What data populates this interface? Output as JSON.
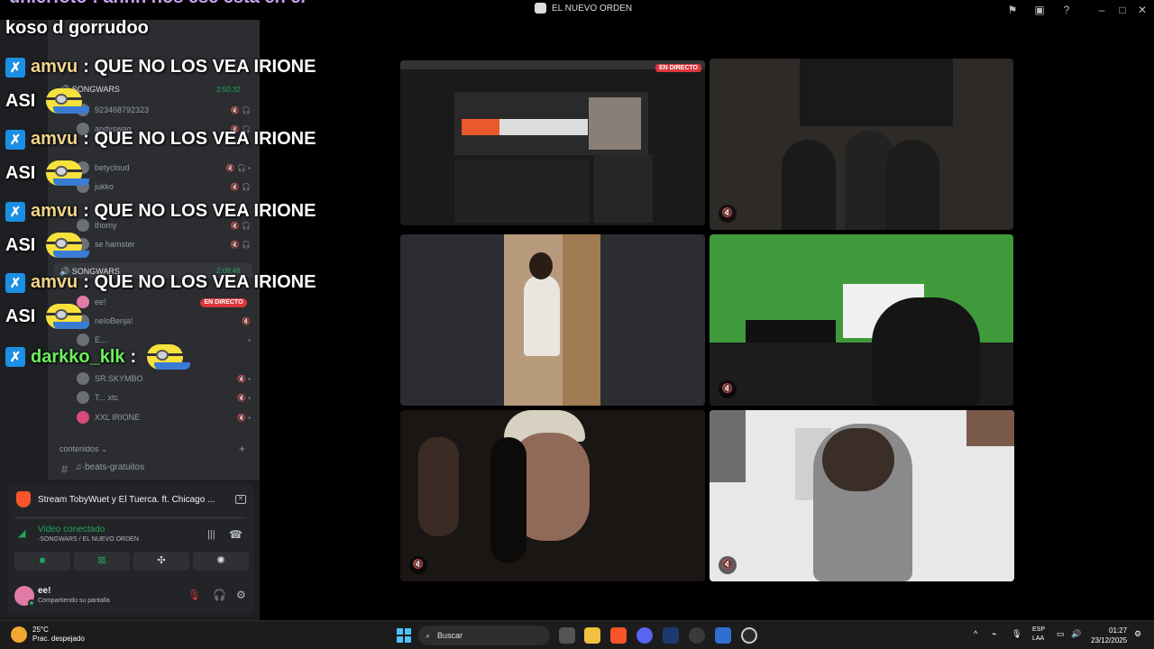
{
  "window": {
    "title": "EL NUEVO ORDEN"
  },
  "chat": {
    "top_partial_line": "unierfoto : ahhh nos ese esta en el",
    "top_line_2": "koso d gorrudoo",
    "messages": [
      {
        "user": "amvu",
        "text": ": QUE NO LOS VEA IRIONE",
        "cont": "ASI"
      },
      {
        "user": "amvu",
        "text": ": QUE NO LOS VEA IRIONE",
        "cont": "ASI"
      },
      {
        "user": "amvu",
        "text": ": QUE NO LOS VEA IRIONE",
        "cont": "ASI"
      },
      {
        "user": "amvu",
        "text": ": QUE NO LOS VEA IRIONE",
        "cont": "ASI"
      }
    ],
    "last_user": "darkko_klk",
    "last_sep": ":"
  },
  "sidebar": {
    "voice_channel_1": "SONGWARS",
    "voice_channel_1_timer": "2:50:32",
    "members_1": [
      "923468792323",
      "andyswag",
      "betycloud",
      "jukko",
      "thomy",
      "se hamster"
    ],
    "voice_channel_2": "SONGWARS",
    "voice_channel_2_timer": "2:08:46",
    "live_badge": "EN DIRECTO",
    "members_2": [
      "ee!",
      "neloBenja!",
      "E...",
      "SR.SKYMBO",
      "T... xtc",
      "XXL IRIONE"
    ],
    "section": "contenidos",
    "text_channel": "♫·beats-gratuitos"
  },
  "panel": {
    "stream_title": "Stream TobyWuet y El Tuerca. ft. Chicago ...",
    "voice_status": "Video conectado",
    "voice_location": "·SONGWARS / EL NUEVO ORDEN",
    "username": "ee!",
    "user_status": "Compartiendo su pantalla"
  },
  "tiles": {
    "live_label": "EN DIRECTO"
  },
  "taskbar": {
    "temperature": "25°C",
    "weather": "Prac. despejado",
    "search_placeholder": "Buscar",
    "lang_1": "ESP",
    "lang_2": "LAA",
    "time": "01:27",
    "date": "23/12/2025"
  },
  "colors": {
    "discord_bg": "#1e1f22",
    "channel_bg": "#2b2d31",
    "online_green": "#23a55a",
    "live_red": "#da373c",
    "kick_blue": "#1a8fe3"
  }
}
